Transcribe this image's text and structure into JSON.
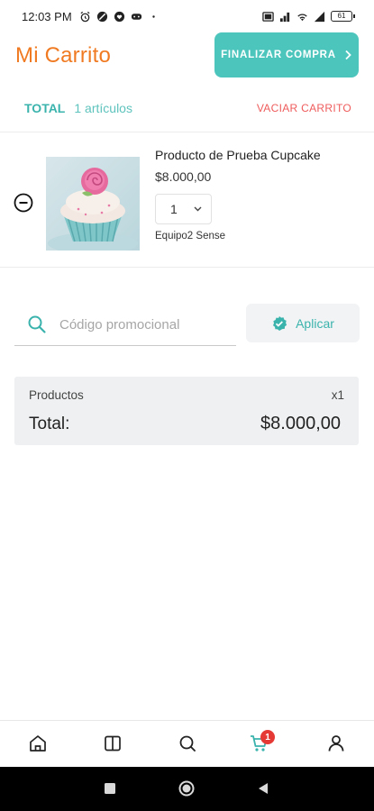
{
  "status_bar": {
    "time": "12:03 PM",
    "battery": "61",
    "icons_left": [
      "alarm-icon",
      "circle-slash-icon",
      "heart-chat-icon",
      "controller-icon",
      "dot-icon"
    ],
    "icons_right": [
      "screen-icon",
      "signal-icon",
      "wifi-icon",
      "signal-bars-icon",
      "battery-icon"
    ]
  },
  "header": {
    "title": "Mi Carrito",
    "checkout_label": "FINALIZAR COMPRA",
    "checkout_icon": "chevron-right-icon"
  },
  "summary": {
    "total_label": "TOTAL",
    "items_count": "1 artículos",
    "clear_label": "VACIAR CARRITO"
  },
  "cart_items": [
    {
      "name": "Producto de Prueba Cupcake",
      "price": "$8.000,00",
      "quantity": "1",
      "vendor": "Equipo2 Sense"
    }
  ],
  "promo": {
    "placeholder": "Código promocional",
    "apply_label": "Aplicar"
  },
  "totals": {
    "products_label": "Productos",
    "products_qty": "x1",
    "total_label": "Total:",
    "total_value": "$8.000,00"
  },
  "bottom_nav": {
    "items": [
      "home-icon",
      "book-icon",
      "search-icon",
      "cart-icon",
      "user-icon"
    ],
    "cart_badge": "1",
    "active": "cart-icon"
  },
  "colors": {
    "accent": "#4cc5bd",
    "title": "#f07a22",
    "danger": "#ef5b5b",
    "badge": "#e53935"
  }
}
